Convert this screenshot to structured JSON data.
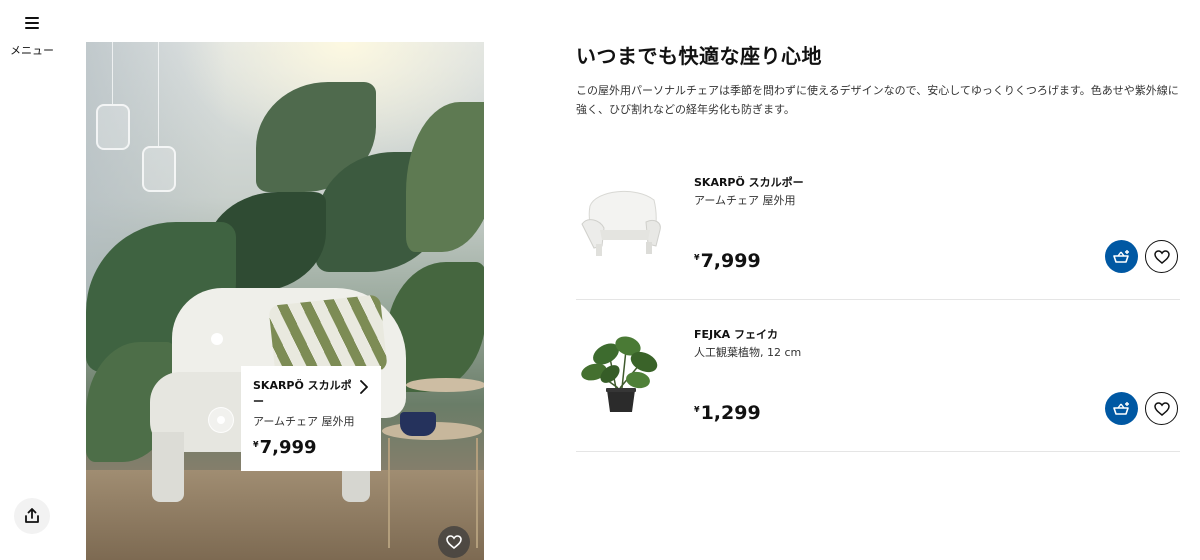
{
  "nav": {
    "menu_label": "メニュー"
  },
  "hero": {
    "popup": {
      "name": "SKARPÖ スカルポー",
      "desc": "アームチェア 屋外用",
      "currency": "¥",
      "price": "7,999"
    }
  },
  "section": {
    "title": "いつまでも快適な座り心地",
    "description": "この屋外用パーソナルチェアは季節を問わずに使えるデザインなので、安心してゆっくりくつろげます。色あせや紫外線に強く、ひび割れなどの経年劣化も防ぎます。"
  },
  "products": [
    {
      "name": "SKARPÖ スカルポー",
      "sub": "アームチェア 屋外用",
      "currency": "¥",
      "price": "7,999",
      "thumb_icon": "white-armchair"
    },
    {
      "name": "FEJKA フェイカ",
      "sub": "人工観葉植物, 12 cm",
      "currency": "¥",
      "price": "1,299",
      "thumb_icon": "potted-plant"
    }
  ],
  "colors": {
    "accent_blue": "#0058a3",
    "text": "#111111"
  }
}
